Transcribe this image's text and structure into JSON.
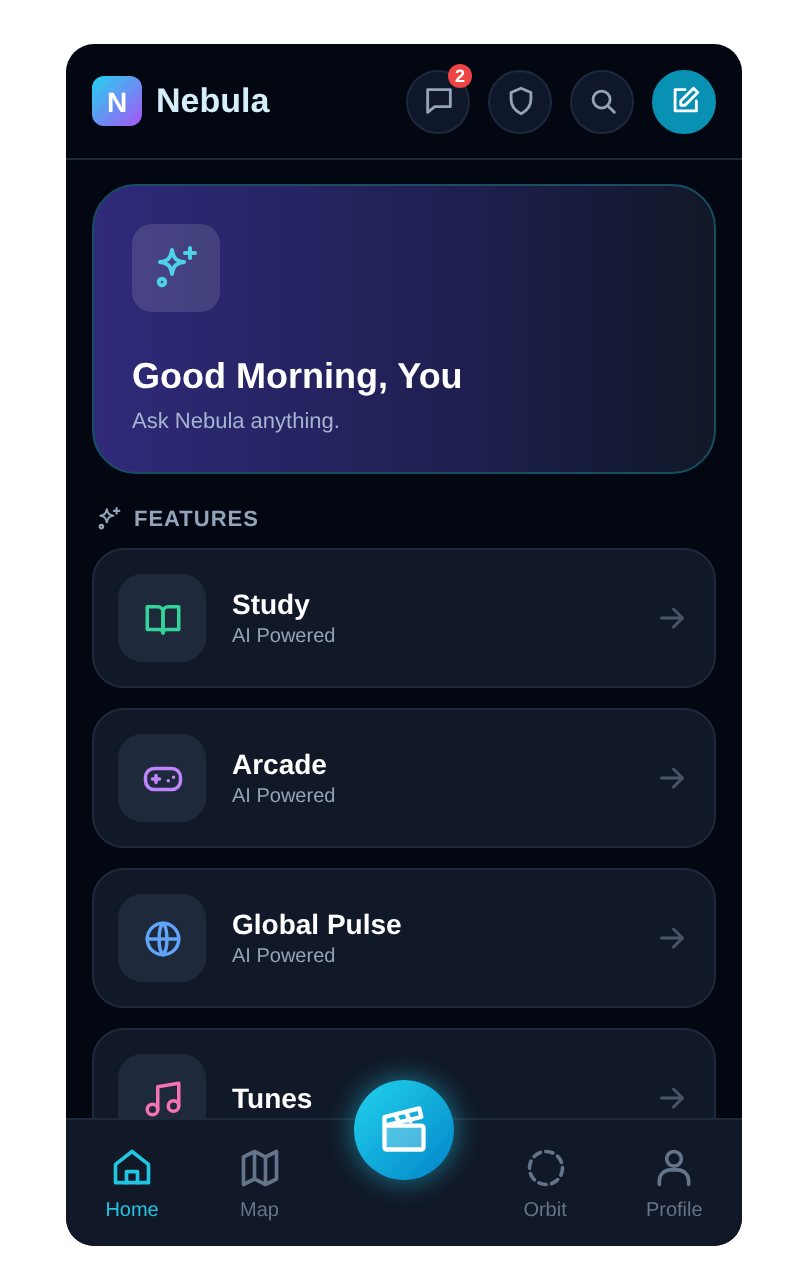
{
  "header": {
    "logo_letter": "N",
    "title": "Nebula",
    "message_badge": "2"
  },
  "hero": {
    "title": "Good Morning, You",
    "subtitle": "Ask Nebula anything."
  },
  "section_title": "FEATURES",
  "features": [
    {
      "kind": "book",
      "title": "Study",
      "subtitle": "AI Powered",
      "color": "#34d399"
    },
    {
      "kind": "gamepad",
      "title": "Arcade",
      "subtitle": "AI Powered",
      "color": "#c084fc"
    },
    {
      "kind": "globe",
      "title": "Global Pulse",
      "subtitle": "AI Powered",
      "color": "#60a5fa"
    },
    {
      "kind": "music",
      "title": "Tunes",
      "color": "#f472b6"
    }
  ],
  "nav": [
    {
      "kind": "home",
      "label": "Home",
      "selected": true
    },
    {
      "kind": "map",
      "label": "Map",
      "selected": false
    },
    {
      "kind": "orbit",
      "label": "Orbit",
      "selected": false
    },
    {
      "kind": "profile",
      "label": "Profile",
      "selected": false
    }
  ]
}
